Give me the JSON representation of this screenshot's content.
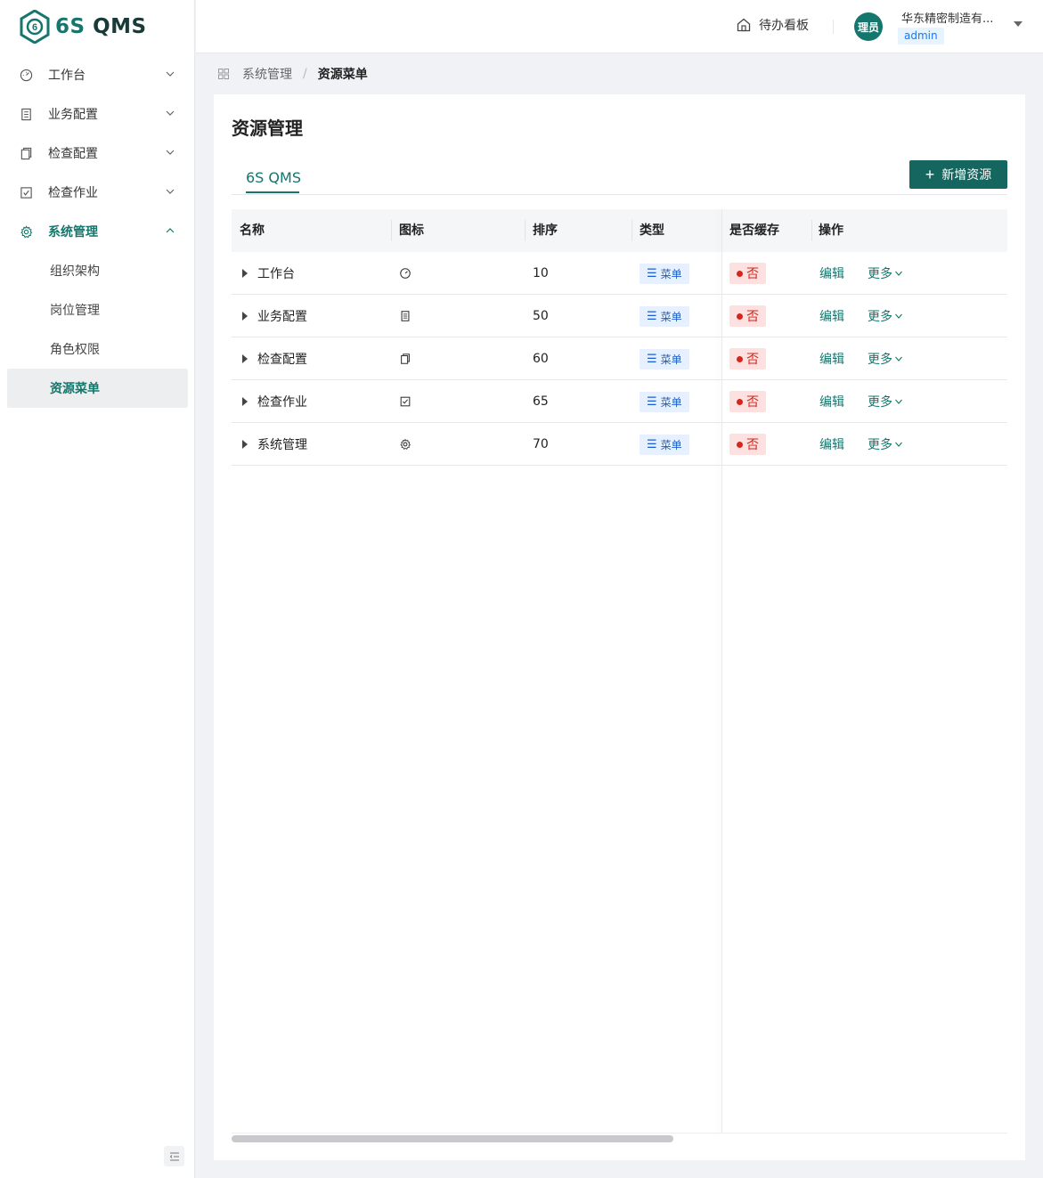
{
  "brand": {
    "name_prefix": "6S",
    "name_suffix": " QMS",
    "accent": "#14766c"
  },
  "sidebar": {
    "items": [
      {
        "label": "工作台",
        "icon": "dashboard-icon",
        "expanded": false
      },
      {
        "label": "业务配置",
        "icon": "ledger-icon",
        "expanded": false
      },
      {
        "label": "检查配置",
        "icon": "clipboard-icon",
        "expanded": false
      },
      {
        "label": "检查作业",
        "icon": "checkbox-icon",
        "expanded": false
      },
      {
        "label": "系统管理",
        "icon": "gear-icon",
        "expanded": true,
        "active": true
      }
    ],
    "subitems": [
      {
        "label": "组织架构"
      },
      {
        "label": "岗位管理"
      },
      {
        "label": "角色权限"
      },
      {
        "label": "资源菜单",
        "selected": true
      }
    ]
  },
  "header": {
    "todo_label": "待办看板",
    "avatar_text": "理员",
    "company": "华东精密制造有...",
    "role": "admin"
  },
  "breadcrumb": {
    "parent": "系统管理",
    "current": "资源菜单"
  },
  "page": {
    "title": "资源管理",
    "tab": "6S QMS",
    "add_button": "新增资源"
  },
  "table": {
    "columns": [
      "名称",
      "图标",
      "排序",
      "类型",
      "是否缓存",
      "操作"
    ],
    "rows": [
      {
        "name": "工作台",
        "icon": "dashboard-icon",
        "sort": "10",
        "type": "菜单",
        "cache": "否",
        "edit": "编辑",
        "more": "更多"
      },
      {
        "name": "业务配置",
        "icon": "ledger-icon",
        "sort": "50",
        "type": "菜单",
        "cache": "否",
        "edit": "编辑",
        "more": "更多"
      },
      {
        "name": "检查配置",
        "icon": "clipboard-icon",
        "sort": "60",
        "type": "菜单",
        "cache": "否",
        "edit": "编辑",
        "more": "更多"
      },
      {
        "name": "检查作业",
        "icon": "checkbox-icon",
        "sort": "65",
        "type": "菜单",
        "cache": "否",
        "edit": "编辑",
        "more": "更多"
      },
      {
        "name": "系统管理",
        "icon": "gear-icon",
        "sort": "70",
        "type": "菜单",
        "cache": "否",
        "edit": "编辑",
        "more": "更多"
      }
    ],
    "horizontal_scroll_position": 0
  }
}
